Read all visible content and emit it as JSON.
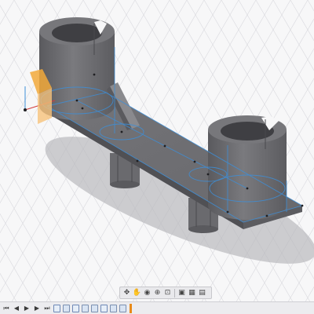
{
  "icons": {
    "view_cube": "view-cube-icon",
    "nav": [
      "orbit-icon",
      "pan-icon",
      "look-at-icon",
      "zoom-icon",
      "fit-icon",
      "display-settings-icon",
      "grid-icon",
      "viewports-icon"
    ],
    "timeline": [
      "first-step-icon",
      "previous-step-icon",
      "play-icon",
      "next-step-icon",
      "last-step-icon"
    ]
  },
  "timeline_features": [
    "sketch",
    "extrude",
    "sketch",
    "extrude",
    "extrude",
    "sketch",
    "extrude",
    "extrude"
  ],
  "colors": {
    "background": "#f7f7f8",
    "grid": "#d6d6dc",
    "body": "#6b6b6f",
    "body_dark": "#4e4e52",
    "sketch": "#3d8fd9",
    "view_cube_accent": "#f2a93b"
  }
}
